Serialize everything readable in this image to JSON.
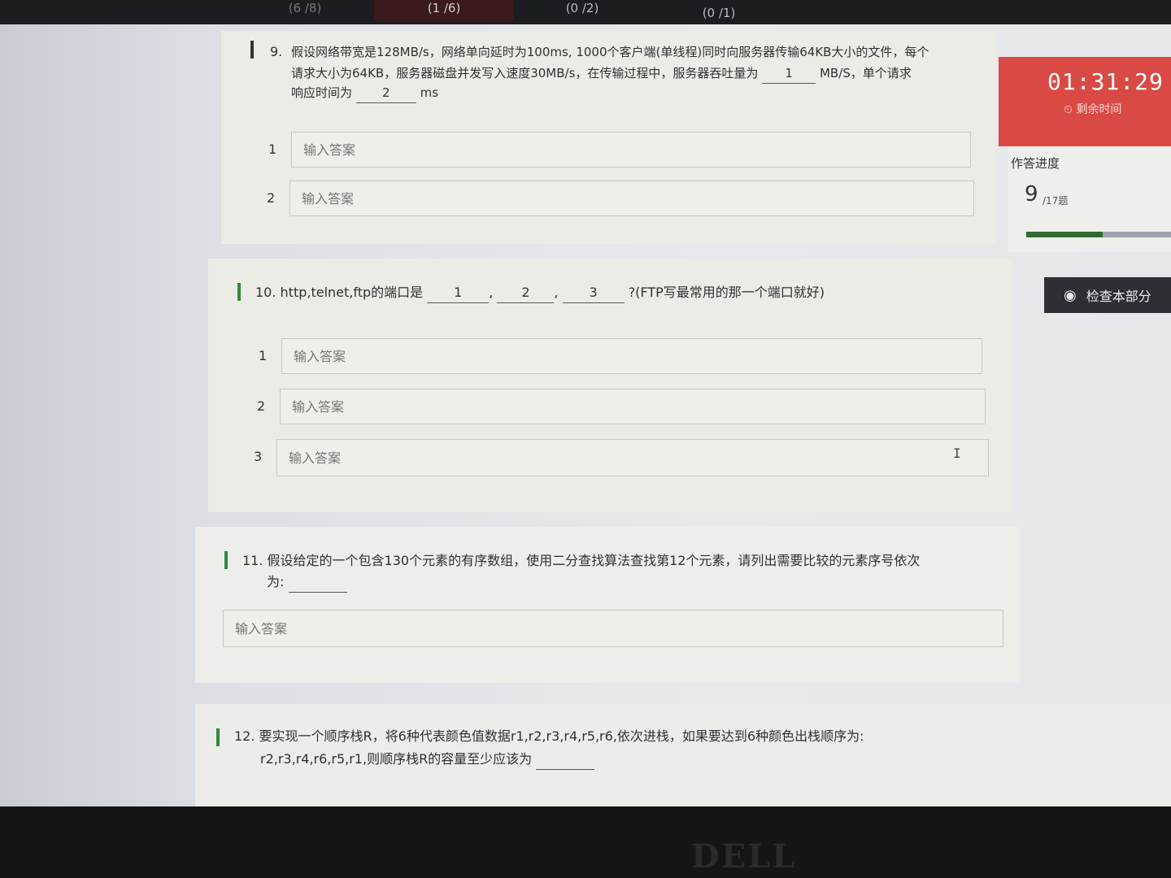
{
  "top_tabs": [
    {
      "label": "(6 /8)"
    },
    {
      "label": "(1 /6)"
    },
    {
      "label": "(0 /2)"
    },
    {
      "label": "(0 /1)"
    }
  ],
  "questions": {
    "q9": {
      "number": "9.",
      "line1": "假设网络带宽是128MB/s，网络单向延时为100ms, 1000个客户端(单线程)同时向服务器传输64KB大小的文件，每个",
      "line2": "请求大小为64KB，服务器磁盘并发写入速度30MB/s，在传输过程中，服务器吞吐量为",
      "line2_end": "MB/S，单个请求",
      "line3": "响应时间为",
      "line3_end": "ms",
      "blank_1": "1",
      "blank_2": "2",
      "rows": [
        {
          "num": "1",
          "placeholder": "输入答案"
        },
        {
          "num": "2",
          "placeholder": "输入答案"
        }
      ]
    },
    "q10": {
      "text_start": "10. http,telnet,ftp的端口是",
      "blank_1": "1",
      "blank_2": "2",
      "blank_3": "3",
      "text_end": "?(FTP写最常用的那一个端口就好)",
      "rows": [
        {
          "num": "1",
          "placeholder": "输入答案"
        },
        {
          "num": "2",
          "placeholder": "输入答案"
        },
        {
          "num": "3",
          "placeholder": "输入答案"
        }
      ]
    },
    "q11": {
      "line1": "11. 假设给定的一个包含130个元素的有序数组，使用二分查找算法查找第12个元素，请列出需要比较的元素序号依次",
      "line2": "为:",
      "placeholder": "输入答案"
    },
    "q12": {
      "line1": "12. 要实现一个顺序栈R，将6种代表颜色值数据r1,r2,r3,r4,r5,r6,依次进栈，如果要达到6种颜色出栈顺序为:",
      "line2": "r2,r3,r4,r6,r5,r1,则顺序栈R的容量至少应该为"
    }
  },
  "sidebar": {
    "timer": "01:31:29",
    "timer_label": "剩余时间",
    "progress_title": "作答进度",
    "progress_done": "9",
    "progress_total": "/17题",
    "progress_fraction": 0.53,
    "check_button": "检查本部分"
  },
  "device_logo": "DELL",
  "colors": {
    "accent_green": "#2f8a3a",
    "timer_red": "#d94a45",
    "progress_fill": "#2c6b2f",
    "check_button_bg": "#2c3035"
  }
}
